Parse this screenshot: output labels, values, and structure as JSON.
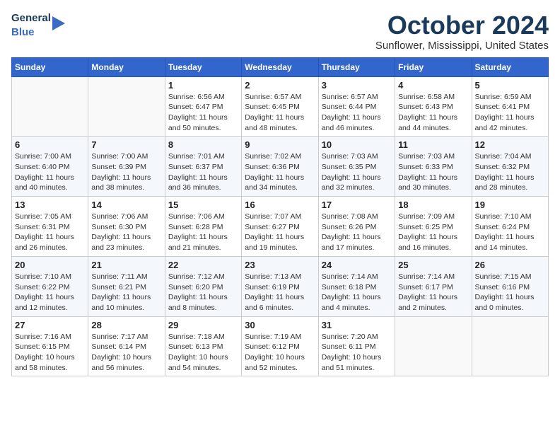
{
  "header": {
    "logo_line1": "General",
    "logo_line2": "Blue",
    "month": "October 2024",
    "location": "Sunflower, Mississippi, United States"
  },
  "days_of_week": [
    "Sunday",
    "Monday",
    "Tuesday",
    "Wednesday",
    "Thursday",
    "Friday",
    "Saturday"
  ],
  "weeks": [
    [
      {
        "date": "",
        "sunrise": "",
        "sunset": "",
        "daylight": ""
      },
      {
        "date": "",
        "sunrise": "",
        "sunset": "",
        "daylight": ""
      },
      {
        "date": "1",
        "sunrise": "Sunrise: 6:56 AM",
        "sunset": "Sunset: 6:47 PM",
        "daylight": "Daylight: 11 hours and 50 minutes."
      },
      {
        "date": "2",
        "sunrise": "Sunrise: 6:57 AM",
        "sunset": "Sunset: 6:45 PM",
        "daylight": "Daylight: 11 hours and 48 minutes."
      },
      {
        "date": "3",
        "sunrise": "Sunrise: 6:57 AM",
        "sunset": "Sunset: 6:44 PM",
        "daylight": "Daylight: 11 hours and 46 minutes."
      },
      {
        "date": "4",
        "sunrise": "Sunrise: 6:58 AM",
        "sunset": "Sunset: 6:43 PM",
        "daylight": "Daylight: 11 hours and 44 minutes."
      },
      {
        "date": "5",
        "sunrise": "Sunrise: 6:59 AM",
        "sunset": "Sunset: 6:41 PM",
        "daylight": "Daylight: 11 hours and 42 minutes."
      }
    ],
    [
      {
        "date": "6",
        "sunrise": "Sunrise: 7:00 AM",
        "sunset": "Sunset: 6:40 PM",
        "daylight": "Daylight: 11 hours and 40 minutes."
      },
      {
        "date": "7",
        "sunrise": "Sunrise: 7:00 AM",
        "sunset": "Sunset: 6:39 PM",
        "daylight": "Daylight: 11 hours and 38 minutes."
      },
      {
        "date": "8",
        "sunrise": "Sunrise: 7:01 AM",
        "sunset": "Sunset: 6:37 PM",
        "daylight": "Daylight: 11 hours and 36 minutes."
      },
      {
        "date": "9",
        "sunrise": "Sunrise: 7:02 AM",
        "sunset": "Sunset: 6:36 PM",
        "daylight": "Daylight: 11 hours and 34 minutes."
      },
      {
        "date": "10",
        "sunrise": "Sunrise: 7:03 AM",
        "sunset": "Sunset: 6:35 PM",
        "daylight": "Daylight: 11 hours and 32 minutes."
      },
      {
        "date": "11",
        "sunrise": "Sunrise: 7:03 AM",
        "sunset": "Sunset: 6:33 PM",
        "daylight": "Daylight: 11 hours and 30 minutes."
      },
      {
        "date": "12",
        "sunrise": "Sunrise: 7:04 AM",
        "sunset": "Sunset: 6:32 PM",
        "daylight": "Daylight: 11 hours and 28 minutes."
      }
    ],
    [
      {
        "date": "13",
        "sunrise": "Sunrise: 7:05 AM",
        "sunset": "Sunset: 6:31 PM",
        "daylight": "Daylight: 11 hours and 26 minutes."
      },
      {
        "date": "14",
        "sunrise": "Sunrise: 7:06 AM",
        "sunset": "Sunset: 6:30 PM",
        "daylight": "Daylight: 11 hours and 23 minutes."
      },
      {
        "date": "15",
        "sunrise": "Sunrise: 7:06 AM",
        "sunset": "Sunset: 6:28 PM",
        "daylight": "Daylight: 11 hours and 21 minutes."
      },
      {
        "date": "16",
        "sunrise": "Sunrise: 7:07 AM",
        "sunset": "Sunset: 6:27 PM",
        "daylight": "Daylight: 11 hours and 19 minutes."
      },
      {
        "date": "17",
        "sunrise": "Sunrise: 7:08 AM",
        "sunset": "Sunset: 6:26 PM",
        "daylight": "Daylight: 11 hours and 17 minutes."
      },
      {
        "date": "18",
        "sunrise": "Sunrise: 7:09 AM",
        "sunset": "Sunset: 6:25 PM",
        "daylight": "Daylight: 11 hours and 16 minutes."
      },
      {
        "date": "19",
        "sunrise": "Sunrise: 7:10 AM",
        "sunset": "Sunset: 6:24 PM",
        "daylight": "Daylight: 11 hours and 14 minutes."
      }
    ],
    [
      {
        "date": "20",
        "sunrise": "Sunrise: 7:10 AM",
        "sunset": "Sunset: 6:22 PM",
        "daylight": "Daylight: 11 hours and 12 minutes."
      },
      {
        "date": "21",
        "sunrise": "Sunrise: 7:11 AM",
        "sunset": "Sunset: 6:21 PM",
        "daylight": "Daylight: 11 hours and 10 minutes."
      },
      {
        "date": "22",
        "sunrise": "Sunrise: 7:12 AM",
        "sunset": "Sunset: 6:20 PM",
        "daylight": "Daylight: 11 hours and 8 minutes."
      },
      {
        "date": "23",
        "sunrise": "Sunrise: 7:13 AM",
        "sunset": "Sunset: 6:19 PM",
        "daylight": "Daylight: 11 hours and 6 minutes."
      },
      {
        "date": "24",
        "sunrise": "Sunrise: 7:14 AM",
        "sunset": "Sunset: 6:18 PM",
        "daylight": "Daylight: 11 hours and 4 minutes."
      },
      {
        "date": "25",
        "sunrise": "Sunrise: 7:14 AM",
        "sunset": "Sunset: 6:17 PM",
        "daylight": "Daylight: 11 hours and 2 minutes."
      },
      {
        "date": "26",
        "sunrise": "Sunrise: 7:15 AM",
        "sunset": "Sunset: 6:16 PM",
        "daylight": "Daylight: 11 hours and 0 minutes."
      }
    ],
    [
      {
        "date": "27",
        "sunrise": "Sunrise: 7:16 AM",
        "sunset": "Sunset: 6:15 PM",
        "daylight": "Daylight: 10 hours and 58 minutes."
      },
      {
        "date": "28",
        "sunrise": "Sunrise: 7:17 AM",
        "sunset": "Sunset: 6:14 PM",
        "daylight": "Daylight: 10 hours and 56 minutes."
      },
      {
        "date": "29",
        "sunrise": "Sunrise: 7:18 AM",
        "sunset": "Sunset: 6:13 PM",
        "daylight": "Daylight: 10 hours and 54 minutes."
      },
      {
        "date": "30",
        "sunrise": "Sunrise: 7:19 AM",
        "sunset": "Sunset: 6:12 PM",
        "daylight": "Daylight: 10 hours and 52 minutes."
      },
      {
        "date": "31",
        "sunrise": "Sunrise: 7:20 AM",
        "sunset": "Sunset: 6:11 PM",
        "daylight": "Daylight: 10 hours and 51 minutes."
      },
      {
        "date": "",
        "sunrise": "",
        "sunset": "",
        "daylight": ""
      },
      {
        "date": "",
        "sunrise": "",
        "sunset": "",
        "daylight": ""
      }
    ]
  ]
}
